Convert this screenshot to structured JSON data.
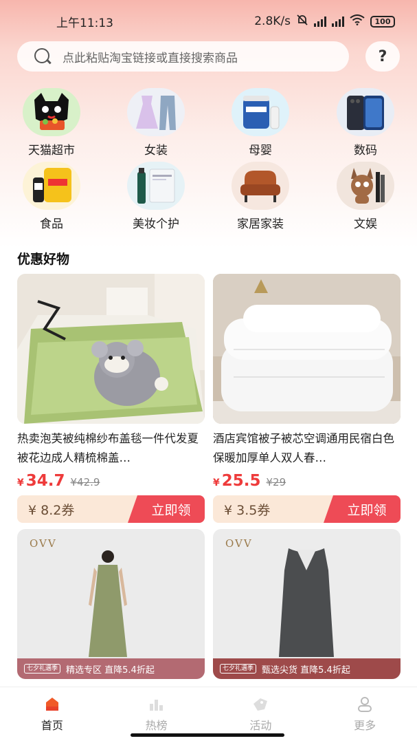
{
  "status_bar": {
    "time": "上午11:13",
    "network_speed": "2.8K/s",
    "battery": "100"
  },
  "search": {
    "placeholder": "点此粘贴淘宝链接或直接搜索商品",
    "help_label": "?"
  },
  "categories": [
    {
      "label": "天猫超市",
      "icon": "tmall-cat-icon"
    },
    {
      "label": "女装",
      "icon": "dress-icon"
    },
    {
      "label": "母婴",
      "icon": "milk-powder-icon"
    },
    {
      "label": "数码",
      "icon": "phone-icon"
    },
    {
      "label": "食品",
      "icon": "snack-icon"
    },
    {
      "label": "美妆个护",
      "icon": "cosmetics-icon"
    },
    {
      "label": "家居家装",
      "icon": "armchair-icon"
    },
    {
      "label": "文娱",
      "icon": "plush-toy-icon"
    }
  ],
  "section_title": "优惠好物",
  "products": [
    {
      "title": "热卖泡芙被纯棉纱布盖毯一件代发夏被花边成人精梳棉盖…",
      "currency": "¥",
      "price": "34.7",
      "original_price": "¥42.9",
      "coupon": "¥ 8.2券",
      "claim_label": "立即领"
    },
    {
      "title": "酒店宾馆被子被芯空调通用民宿白色保暖加厚单人双人春…",
      "currency": "¥",
      "price": "25.5",
      "original_price": "¥29",
      "coupon": "¥ 3.5券",
      "claim_label": "立即领"
    }
  ],
  "banners": [
    {
      "brand": "OVV",
      "promo_logo": "七夕礼遇季",
      "promo_text": "精选专区 直降5.4折起"
    },
    {
      "brand": "OVV",
      "promo_logo": "七夕礼遇季",
      "promo_text": "甄选尖货 直降5.4折起"
    }
  ],
  "bottom_nav": [
    {
      "label": "首页",
      "icon": "home-icon",
      "active": true
    },
    {
      "label": "热榜",
      "icon": "chart-icon",
      "active": false
    },
    {
      "label": "活动",
      "icon": "tag-icon",
      "active": false
    },
    {
      "label": "更多",
      "icon": "user-icon",
      "active": false
    }
  ],
  "colors": {
    "accent": "#ee3b3b",
    "claim_button": "#ee4b56",
    "coupon_bg": "#fbe8d8"
  }
}
